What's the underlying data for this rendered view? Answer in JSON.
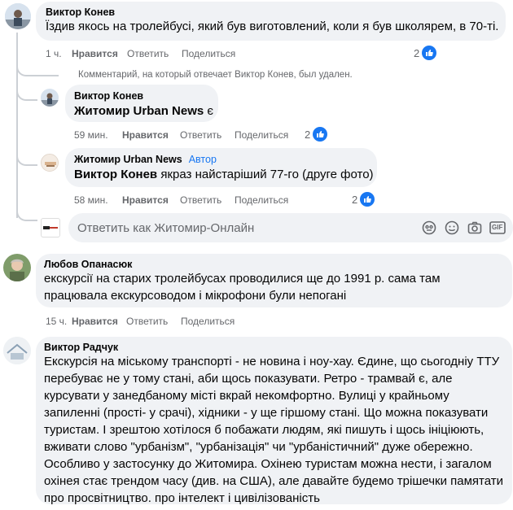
{
  "colors": {
    "accent": "#1877f2",
    "muted": "#65676b",
    "bubble": "#f0f2f5"
  },
  "comments": [
    {
      "author": "Виктор Конев",
      "text": "Їздив якось на тролейбусі, який був виготовлений, коли я був школярем, в 70-ті.",
      "time": "1 ч.",
      "like": "Нравится",
      "reply": "Ответить",
      "share": "Поделиться",
      "reactions": "2"
    },
    {
      "deleted_notice": "Комментарий, на который отвечает Виктор Конев, был удален."
    },
    {
      "author": "Виктор Конев",
      "mention": "Житомир Urban News",
      "text_rest": " є",
      "time": "59 мин.",
      "like": "Нравится",
      "reply": "Ответить",
      "share": "Поделиться",
      "reactions": "2"
    },
    {
      "author": "Житомир Urban News",
      "badge": "Автор",
      "mention": "Виктор Конев",
      "text_rest": " якраз найстаріший 77-го (друге фото)",
      "time": "58 мин.",
      "like": "Нравится",
      "reply": "Ответить",
      "share": "Поделиться",
      "reactions": "2"
    },
    {
      "author": "Любов Опанасюк",
      "text": "екскурсії на старих тролейбусах проводилися ще до 1991 р. сама там працювала екскурсоводом і мікрофони були непогані",
      "time": "15 ч.",
      "like": "Нравится",
      "reply": "Ответить",
      "share": "Поделиться"
    },
    {
      "author": "Виктор Радчук",
      "text": "Екскурсія на міському транспорті - не новина і ноу-хау. Єдине, що сьогодніу ТТУ перебуває не у тому стані, аби щось показувати. Ретро - трамвай є, але курсувати у занедбаному місті вкрай некомфортно. Вулиці у крайньому запиленні (прості- у срачі), хідники - у ще гіршому стані. Що можна показувати туристам. І зрештою хотілося б побажати людям, які пишуть і щось ініціюють, вживати слово \"урбанізм\", \"урбанізація\" чи \"урбаністичний\" дуже обережно. Особливо у застосунку до Житомира. Охінею туристам можна нести, і загалом охінея стає трендом часу (див. на США), але давайте будемо трішечки памятати про просвітництво. про інтелект і цивілізованість"
    }
  ],
  "reply_box": {
    "placeholder": "Ответить как Житомир-Онлайн",
    "icons": [
      "avatar-sticker-icon",
      "emoji-icon",
      "camera-icon",
      "gif-icon"
    ],
    "gif_label": "GIF"
  },
  "page_avatar_label": "Urban News"
}
